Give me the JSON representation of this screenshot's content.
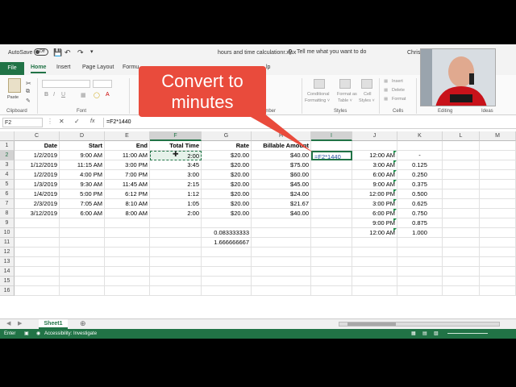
{
  "titlebar": {
    "autosave": "AutoSave",
    "toggle": "Off",
    "document": "hours and time calculationr.xlsx",
    "search": "Tell me what you want to do",
    "user": "Chris M"
  },
  "tabs": [
    "File",
    "Home",
    "Insert",
    "Page Layout",
    "Formu",
    "lp"
  ],
  "ribbon": {
    "paste": "Paste",
    "clipboard": "Clipboard",
    "font": "Font",
    "number": "umber",
    "cond_fmt_1": "Conditional",
    "cond_fmt_2": "Formatting ˅",
    "fmt_table_1": "Format as",
    "fmt_table_2": "Table ˅",
    "cell_styles_1": "Cell",
    "cell_styles_2": "Styles ˅",
    "styles": "Styles",
    "insert": "Insert",
    "delete": "Delete",
    "format": "Format",
    "cells": "Cells",
    "editing": "Editing",
    "ideas": "Ideas"
  },
  "callout": {
    "line1": "Convert to",
    "line2": "minutes"
  },
  "formula_bar": {
    "name_box": "F2",
    "fx": "fx",
    "formula": "=F2*1440"
  },
  "columns": [
    "C",
    "D",
    "E",
    "F",
    "G",
    "H",
    "I",
    "J",
    "K",
    "L",
    "M"
  ],
  "rows": [
    "1",
    "2",
    "3",
    "4",
    "5",
    "6",
    "7",
    "8",
    "9",
    "10",
    "11",
    "12",
    "13",
    "14",
    "15",
    "16"
  ],
  "headers": {
    "date": "Date",
    "start": "Start",
    "end": "End",
    "total": "Total Time",
    "rate": "Rate",
    "billable": "Billable Amount"
  },
  "data_rows": [
    {
      "date": "1/2/2019",
      "start": "9:00 AM",
      "end": "11:00 AM",
      "total": "2:00",
      "rate": "$20.00",
      "bill": "$40.00",
      "i": "=F2*1440",
      "j": "12:00 AM",
      "k": "-"
    },
    {
      "date": "1/12/2019",
      "start": "11:15 AM",
      "end": "3:00 PM",
      "total": "3:45",
      "rate": "$20.00",
      "bill": "$75.00",
      "i": "",
      "j": "3:00 AM",
      "k": "0.125"
    },
    {
      "date": "1/2/2019",
      "start": "4:00 PM",
      "end": "7:00 PM",
      "total": "3:00",
      "rate": "$20.00",
      "bill": "$60.00",
      "i": "",
      "j": "6:00 AM",
      "k": "0.250"
    },
    {
      "date": "1/3/2019",
      "start": "9:30 AM",
      "end": "11:45 AM",
      "total": "2:15",
      "rate": "$20.00",
      "bill": "$45.00",
      "i": "",
      "j": "9:00 AM",
      "k": "0.375"
    },
    {
      "date": "1/4/2019",
      "start": "5:00 PM",
      "end": "6:12 PM",
      "total": "1:12",
      "rate": "$20.00",
      "bill": "$24.00",
      "i": "",
      "j": "12:00 PM",
      "k": "0.500"
    },
    {
      "date": "2/3/2019",
      "start": "7:05 AM",
      "end": "8:10 AM",
      "total": "1:05",
      "rate": "$20.00",
      "bill": "$21.67",
      "i": "",
      "j": "3:00 PM",
      "k": "0.625"
    },
    {
      "date": "3/12/2019",
      "start": "6:00 AM",
      "end": "8:00 AM",
      "total": "2:00",
      "rate": "$20.00",
      "bill": "$40.00",
      "i": "",
      "j": "6:00 PM",
      "k": "0.750"
    },
    {
      "date": "",
      "start": "",
      "end": "",
      "total": "",
      "rate": "",
      "bill": "",
      "i": "",
      "j": "9:00 PM",
      "k": "0.875"
    },
    {
      "date": "",
      "start": "",
      "end": "",
      "total": "",
      "rate": "0.083333333",
      "bill": "",
      "i": "",
      "j": "12:00 AM",
      "k": "1.000"
    },
    {
      "date": "",
      "start": "",
      "end": "",
      "total": "",
      "rate": "1.666666667",
      "bill": "",
      "i": "",
      "j": "",
      "k": ""
    }
  ],
  "sheet_tab": "Sheet1",
  "status": {
    "mode": "Enter",
    "accessibility": "Accessibility: Investigate"
  }
}
